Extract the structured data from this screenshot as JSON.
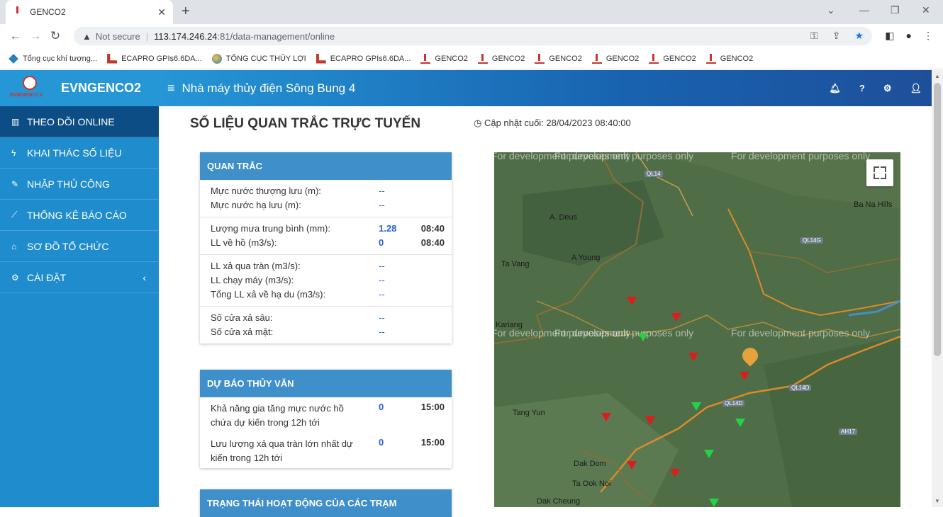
{
  "browser": {
    "tab_title": "GENCO2",
    "security_label": "Not secure",
    "url_host": "113.174.246.24",
    "url_path": ":81/data-management/online"
  },
  "bookmarks": [
    {
      "label": "Tổng cục khí tượng...",
      "icon": "diamond"
    },
    {
      "label": "ECAPRO GPIs6.6DA...",
      "icon": "red"
    },
    {
      "label": "TỔNG CỤC THỦY LỢI",
      "icon": "globe"
    },
    {
      "label": "ECAPRO GPIs6.6DA...",
      "icon": "red"
    },
    {
      "label": "GENCO2",
      "icon": "gen"
    },
    {
      "label": "GENCO2",
      "icon": "gen"
    },
    {
      "label": "GENCO2",
      "icon": "gen"
    },
    {
      "label": "GENCO2",
      "icon": "gen"
    },
    {
      "label": "GENCO2",
      "icon": "gen"
    },
    {
      "label": "GENCO2",
      "icon": "gen"
    }
  ],
  "brand": {
    "name": "EVNGENCO2",
    "logo_text": "EVNGENCO 2"
  },
  "sidebar": {
    "items": [
      {
        "label": "THEO DÕI ONLINE",
        "icon": "chart-icon"
      },
      {
        "label": "KHAI THÁC SỐ LIỆU",
        "icon": "bolt-icon"
      },
      {
        "label": "NHẬP THỦ CÔNG",
        "icon": "edit-icon"
      },
      {
        "label": "THỐNG KÊ BÁO CÁO",
        "icon": "line-chart-icon"
      },
      {
        "label": "SƠ ĐỒ TỔ CHỨC",
        "icon": "bank-icon"
      },
      {
        "label": "CÀI ĐẶT",
        "icon": "gear-icon"
      }
    ]
  },
  "header": {
    "plant_name": "Nhà máy thủy điện Sông Bung 4"
  },
  "page": {
    "title": "SỐ LIỆU QUAN TRẮC TRỰC TUYẾN",
    "updated_label": "Cập nhật cuối: 28/04/2023 08:40:00"
  },
  "observation": {
    "title": "QUAN TRẮC",
    "groups": [
      [
        {
          "label": "Mực nước thượng lưu (m):",
          "value": "--",
          "time": ""
        },
        {
          "label": "Mực nước hạ lưu (m):",
          "value": "--",
          "time": ""
        }
      ],
      [
        {
          "label": "Lượng mưa trung bình (mm):",
          "value": "1.28",
          "time": "08:40"
        },
        {
          "label": "LL về hồ (m3/s):",
          "value": "0",
          "time": "08:40"
        }
      ],
      [
        {
          "label": "LL xả qua tràn (m3/s):",
          "value": "--",
          "time": ""
        },
        {
          "label": "LL chạy máy (m3/s):",
          "value": "--",
          "time": ""
        },
        {
          "label": "Tổng LL xả về hạ du (m3/s):",
          "value": "--",
          "time": ""
        }
      ],
      [
        {
          "label": "Số cửa xả sâu:",
          "value": "--",
          "time": ""
        },
        {
          "label": "Số cửa xả mặt:",
          "value": "--",
          "time": ""
        }
      ]
    ]
  },
  "forecast": {
    "title": "DỰ BÁO THỦY VĂN",
    "rows": [
      {
        "label": "Khả năng gia tăng mực nước hồ chứa dự kiến trong 12h tới",
        "value": "0",
        "time": "15:00"
      },
      {
        "label": "Lưu lượng xả qua tràn lớn nhất dự kiến trong 12h tới",
        "value": "0",
        "time": "15:00"
      }
    ]
  },
  "station_status": {
    "title": "TRẠNG THÁI HOẠT ĐỘNG CỦA CÁC TRẠM"
  },
  "map": {
    "watermark": "For development purposes only",
    "places": [
      "A. Deus",
      "Ba Na Hills",
      "A Young",
      "Ta Vang",
      "Kariang",
      "Tang Yun",
      "Dak Dom",
      "Ta Ook Noi",
      "Dak Cheung"
    ],
    "roads": [
      "QL14",
      "QL14G",
      "QL14D",
      "QL14D",
      "AH17"
    ],
    "red_stations": 10,
    "green_stations": 6
  },
  "colors": {
    "sidebar": "#1f8ccd",
    "active_item": "#0d4d85",
    "panel_header": "#3f8fcb",
    "value_blue": "#2a62c8",
    "station_red": "#e01b1b",
    "station_green": "#22d34a"
  }
}
